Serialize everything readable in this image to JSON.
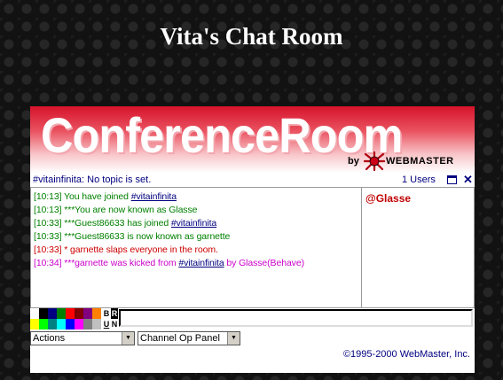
{
  "page": {
    "title": "Vita's Chat Room"
  },
  "banner": {
    "brand": "ConferenceRoom",
    "by": "by",
    "vendor": "WEBMASTER"
  },
  "channel": {
    "topic_line": "#vitainfinita: No topic is set."
  },
  "users": {
    "count_label": "1 Users",
    "list": [
      "@Glasse"
    ]
  },
  "messages": [
    {
      "color": "#008000",
      "parts": [
        {
          "t": "[10:13] You have joined "
        },
        {
          "t": "#vitainfinita",
          "link": true
        }
      ]
    },
    {
      "color": "#008000",
      "parts": [
        {
          "t": "[10:13] ***You are now known as Glasse"
        }
      ]
    },
    {
      "color": "#008000",
      "parts": [
        {
          "t": "[10:33] ***Guest86633 has joined "
        },
        {
          "t": "#vitainfinita",
          "link": true
        }
      ]
    },
    {
      "color": "#008000",
      "parts": [
        {
          "t": "[10:33] ***Guest86633 is now known as garnette"
        }
      ]
    },
    {
      "color": "#cc0000",
      "parts": [
        {
          "t": "[10:33] * garnette slaps everyone in the room."
        }
      ]
    },
    {
      "color": "#cc00cc",
      "parts": [
        {
          "t": "[10:34] ***garnette was kicked from "
        },
        {
          "t": "#vitainfinita",
          "link": true
        },
        {
          "t": " by Glasse(Behave)"
        }
      ]
    }
  ],
  "palette": {
    "row1": [
      "#ffffff",
      "#000000",
      "#000080",
      "#008000",
      "#ff0000",
      "#800000",
      "#800080",
      "#ff8000"
    ],
    "row2": [
      "#ffff00",
      "#00ff00",
      "#008080",
      "#00ffff",
      "#0000ff",
      "#ff00ff",
      "#808080",
      "#c0c0c0"
    ],
    "format_keys": {
      "bold": "B",
      "reverse": "R",
      "underline": "U",
      "normal": "N"
    }
  },
  "input": {
    "value": ""
  },
  "actions_select": {
    "selected": "Actions"
  },
  "channel_op_select": {
    "selected": "Channel Op Panel"
  },
  "footer": {
    "copyright": "©1995-2000 WebMaster, Inc."
  }
}
